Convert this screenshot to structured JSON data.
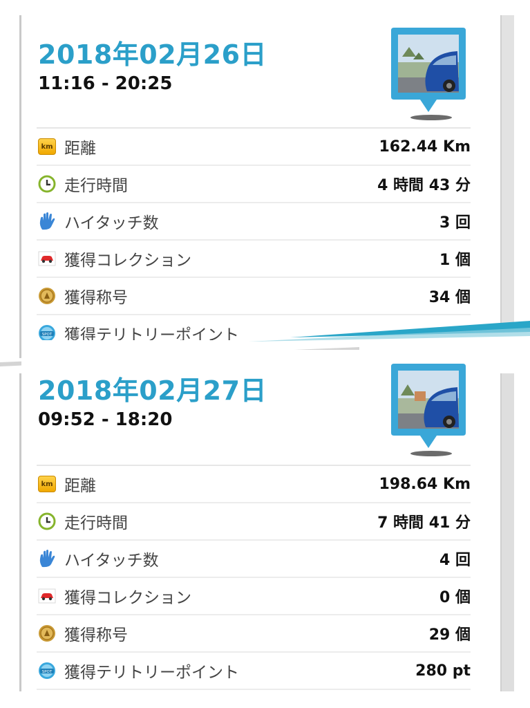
{
  "entries": [
    {
      "date": "2018年02月26日",
      "time": "11:16 - 20:25",
      "stats": [
        {
          "icon": "km-icon",
          "label": "距離",
          "value": "162.44 Km"
        },
        {
          "icon": "clock-icon",
          "label": "走行時間",
          "value": "4 時間 43 分"
        },
        {
          "icon": "hand-icon",
          "label": "ハイタッチ数",
          "value": "3 回"
        },
        {
          "icon": "car-icon",
          "label": "獲得コレクション",
          "value": "1 個"
        },
        {
          "icon": "medal-icon",
          "label": "獲得称号",
          "value": "34 個"
        },
        {
          "icon": "spot-icon",
          "label": "獲得テリトリーポイント",
          "value": ""
        }
      ]
    },
    {
      "date": "2018年02月27日",
      "time": "09:52 - 18:20",
      "stats": [
        {
          "icon": "km-icon",
          "label": "距離",
          "value": "198.64 Km"
        },
        {
          "icon": "clock-icon",
          "label": "走行時間",
          "value": "7 時間 41 分"
        },
        {
          "icon": "hand-icon",
          "label": "ハイタッチ数",
          "value": "4 回"
        },
        {
          "icon": "car-icon",
          "label": "獲得コレクション",
          "value": "0 個"
        },
        {
          "icon": "medal-icon",
          "label": "獲得称号",
          "value": "29 個"
        },
        {
          "icon": "spot-icon",
          "label": "獲得テリトリーポイント",
          "value": "280 pt"
        }
      ]
    }
  ],
  "icon_labels": {
    "km": "km",
    "spot": "SPOT"
  },
  "colors": {
    "date_blue": "#2b9fc9",
    "pin_blue": "#3aa7d8"
  }
}
